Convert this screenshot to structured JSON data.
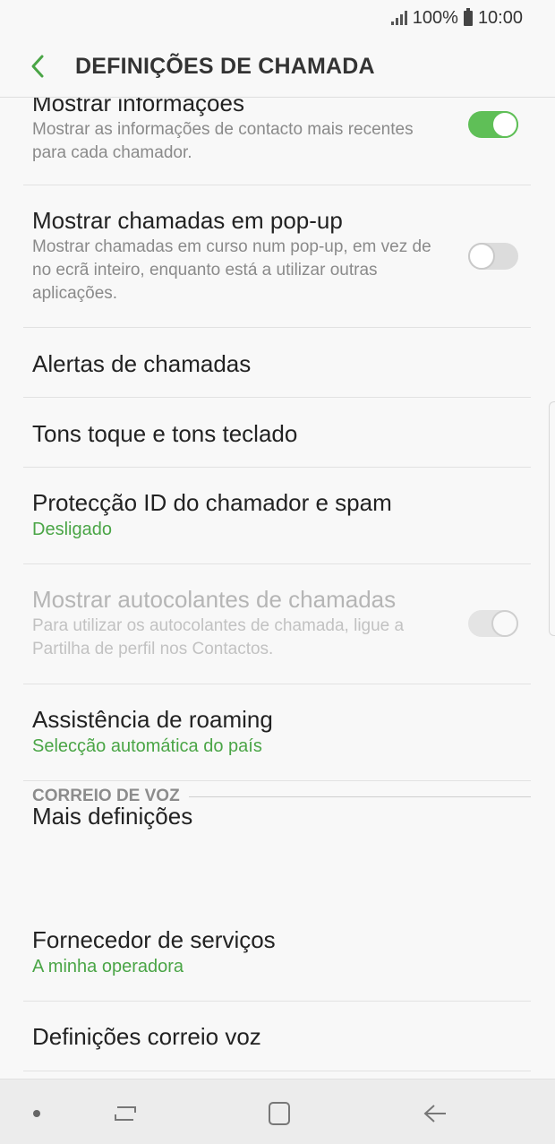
{
  "status_bar": {
    "battery": "100%",
    "time": "10:00"
  },
  "app_bar": {
    "title": "DEFINIÇÕES DE CHAMADA"
  },
  "settings": [
    {
      "title": "Mostrar informações",
      "description": "Mostrar as informações de contacto mais recentes para cada chamador.",
      "toggle": "on"
    },
    {
      "title": "Mostrar chamadas em pop-up",
      "description": "Mostrar chamadas em curso num pop-up, em vez de no ecrã inteiro, enquanto está a utilizar outras aplicações.",
      "toggle": "off"
    },
    {
      "title": "Alertas de chamadas"
    },
    {
      "title": "Tons toque e tons teclado"
    },
    {
      "title": "Protecção ID do chamador e spam",
      "subtitle": "Desligado"
    },
    {
      "title": "Mostrar autocolantes de chamadas",
      "description": "Para utilizar os autocolantes de chamada, ligue a Partilha de perfil nos Contactos.",
      "toggle": "on-disabled"
    },
    {
      "title": "Assistência de roaming",
      "subtitle": "Selecção automática do país"
    },
    {
      "title": "Mais definições"
    }
  ],
  "voicemail_section": {
    "header": "CORREIO DE VOZ",
    "items": [
      {
        "title": "Fornecedor de serviços",
        "subtitle": "A minha operadora"
      },
      {
        "title": "Definições correio voz"
      }
    ]
  },
  "colors": {
    "accent": "#4aa546",
    "toggle_on": "#5fbf57"
  },
  "nav_bar": {
    "buttons": [
      "recent-apps",
      "home",
      "back"
    ]
  }
}
